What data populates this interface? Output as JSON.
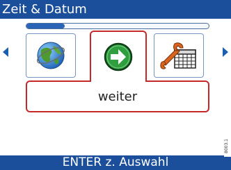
{
  "header": {
    "title": "Zeit & Datum"
  },
  "progress": {
    "value": 0.21
  },
  "menu": {
    "items": [
      {
        "icon": "globe-icon"
      },
      {
        "icon": "next-arrow-icon",
        "selected": true
      },
      {
        "icon": "wrench-calendar-icon"
      }
    ],
    "selected_label": "weiter"
  },
  "footer": {
    "hint": "ENTER z. Auswahl"
  },
  "serial": "8003.1",
  "colors": {
    "bar": "#1b4f9c",
    "selection": "#c62828",
    "ok": "#2e9e3e",
    "arrow": "#1b5fb0"
  }
}
